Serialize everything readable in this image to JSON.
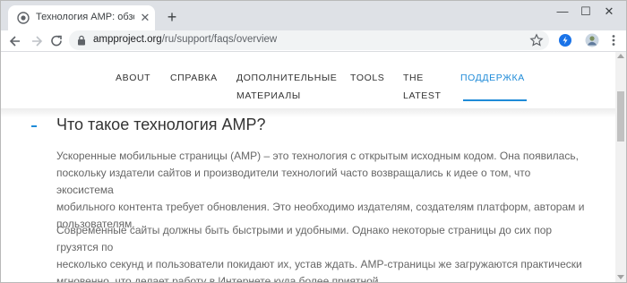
{
  "browser": {
    "tab_title": "Технология AMP: обзор – AMP",
    "url_host": "ampproject.org",
    "url_path": "/ru/support/faqs/overview"
  },
  "site_nav": {
    "items": [
      {
        "label": "ABOUT",
        "active": false
      },
      {
        "label": "СПРАВКА",
        "active": false
      },
      {
        "label": "ДОПОЛНИТЕЛЬНЫЕ",
        "label2": "МАТЕРИАЛЫ",
        "active": false
      },
      {
        "label": "TOOLS",
        "active": false
      },
      {
        "label": "THE",
        "label2": "LATEST",
        "active": false
      },
      {
        "label": "ПОДДЕРЖКА",
        "active": true
      }
    ]
  },
  "faq": {
    "title": "Что такое технология AMP?",
    "paragraphs": [
      {
        "lines": [
          "Ускоренные мобильные страницы (AMP) – это технология с открытым исходным кодом. Она появилась,",
          "поскольку издатели сайтов и производители технологий часто возвращались к идее о том, что экосистема",
          "мобильного контента требует обновления. Это необходимо издателям, создателям платформ, авторам и",
          "пользователям."
        ]
      },
      {
        "lines": [
          "Современные сайты должны быть быстрыми и удобными. Однако некоторые страницы до сих пор грузятся по",
          "несколько секунд и пользователи покидают их, устав ждать. AMP-страницы же загружаются практически",
          "мгновенно, что делает работу в Интернете куда более приятной."
        ]
      }
    ]
  },
  "colors": {
    "accent": "#1f8bd8",
    "tabstrip": "#dee1e6",
    "body_text": "#666666"
  },
  "icons": {
    "tab_favicon": "globe-icon",
    "tab_close": "close-icon",
    "new_tab": "plus-icon",
    "back": "back-arrow-icon",
    "forward": "forward-arrow-icon",
    "reload": "reload-icon",
    "lock": "lock-icon",
    "star": "star-icon",
    "extension": "extension-icon",
    "profile": "avatar-icon",
    "menu": "kebab-menu-icon"
  }
}
